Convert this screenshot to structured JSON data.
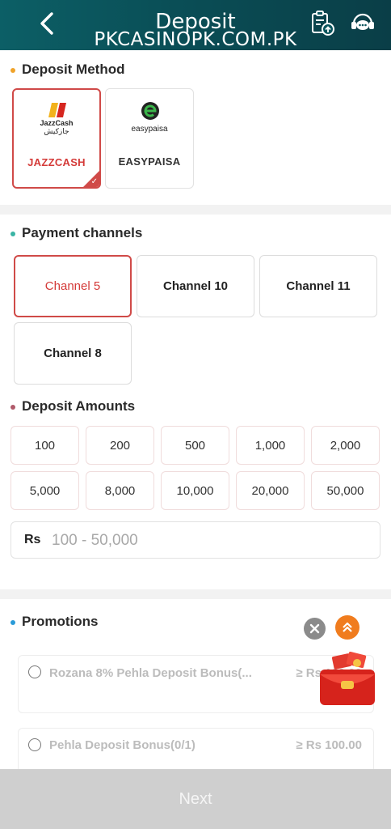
{
  "header": {
    "title": "Deposit",
    "watermark": "PKCASINOPK.COM.PK",
    "back_icon": "chevron-left-icon",
    "records_icon": "clipboard-upload-icon",
    "support_icon": "chat-support-icon"
  },
  "deposit_method": {
    "title": "Deposit Method",
    "dot_color": "#f0a32a",
    "methods": [
      {
        "label": "JAZZCASH",
        "logo_text": "JazzCash",
        "logo_sub": "جازکیش",
        "selected": true
      },
      {
        "label": "EASYPAISA",
        "logo_text": "easypaisa",
        "selected": false
      }
    ]
  },
  "payment_channels": {
    "title": "Payment channels",
    "dot_color": "#3ab4a4",
    "channels": [
      {
        "label": "Channel 5",
        "selected": true
      },
      {
        "label": "Channel 10",
        "selected": false
      },
      {
        "label": "Channel 11",
        "selected": false
      },
      {
        "label": "Channel 8",
        "selected": false
      }
    ]
  },
  "deposit_amounts": {
    "title": "Deposit Amounts",
    "dot_color": "#b05a6a",
    "amounts": [
      "100",
      "200",
      "500",
      "1,000",
      "2,000",
      "5,000",
      "8,000",
      "10,000",
      "20,000",
      "50,000"
    ],
    "currency": "Rs",
    "placeholder": "100 - 50,000"
  },
  "promotions": {
    "title": "Promotions",
    "dot_color": "#2a9bd8",
    "items": [
      {
        "name": "Rozana 8% Pehla Deposit Bonus(...",
        "min": "≥ Rs 100.00"
      },
      {
        "name": "Pehla Deposit Bonus(0/1)",
        "min": "≥ Rs 100.00"
      }
    ]
  },
  "accent_color": "#d04a48",
  "next_label": "Next"
}
